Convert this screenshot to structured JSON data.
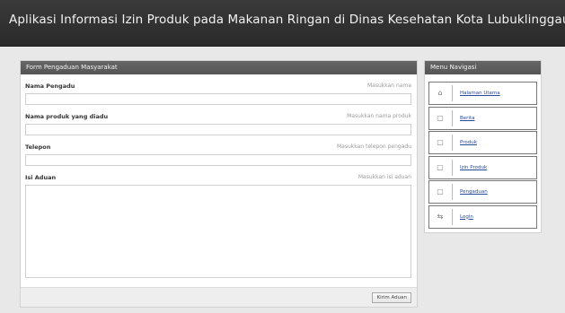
{
  "header": {
    "title": "Aplikasi Informasi Izin Produk pada Makanan Ringan di Dinas Kesehatan Kota Lubuklinggau"
  },
  "form": {
    "title": "Form Pengaduan Masyarakat",
    "fields": [
      {
        "label": "Nama Pengadu",
        "hint": "Masukkan nama",
        "value": ""
      },
      {
        "label": "Nama produk yang diadu",
        "hint": "Masukkan nama produk",
        "value": ""
      },
      {
        "label": "Telepon",
        "hint": "Masukkan telepon pengadu",
        "value": ""
      },
      {
        "label": "Isi Aduan",
        "hint": "Masukkan isi aduan",
        "value": ""
      }
    ],
    "submit_label": "Kirim Aduan"
  },
  "nav": {
    "title": "Menu Navigasi",
    "items": [
      {
        "label": "Halaman Utama",
        "icon": "home-icon",
        "glyph": "⌂"
      },
      {
        "label": "Berita",
        "icon": "news-icon",
        "glyph": "▢"
      },
      {
        "label": "Produk",
        "icon": "product-icon",
        "glyph": "▢"
      },
      {
        "label": "Izin Produk",
        "icon": "permit-icon",
        "glyph": "▢"
      },
      {
        "label": "Pengaduan",
        "icon": "complaint-icon",
        "glyph": "▢"
      },
      {
        "label": "Login",
        "icon": "login-icon",
        "glyph": "⇆"
      }
    ]
  }
}
